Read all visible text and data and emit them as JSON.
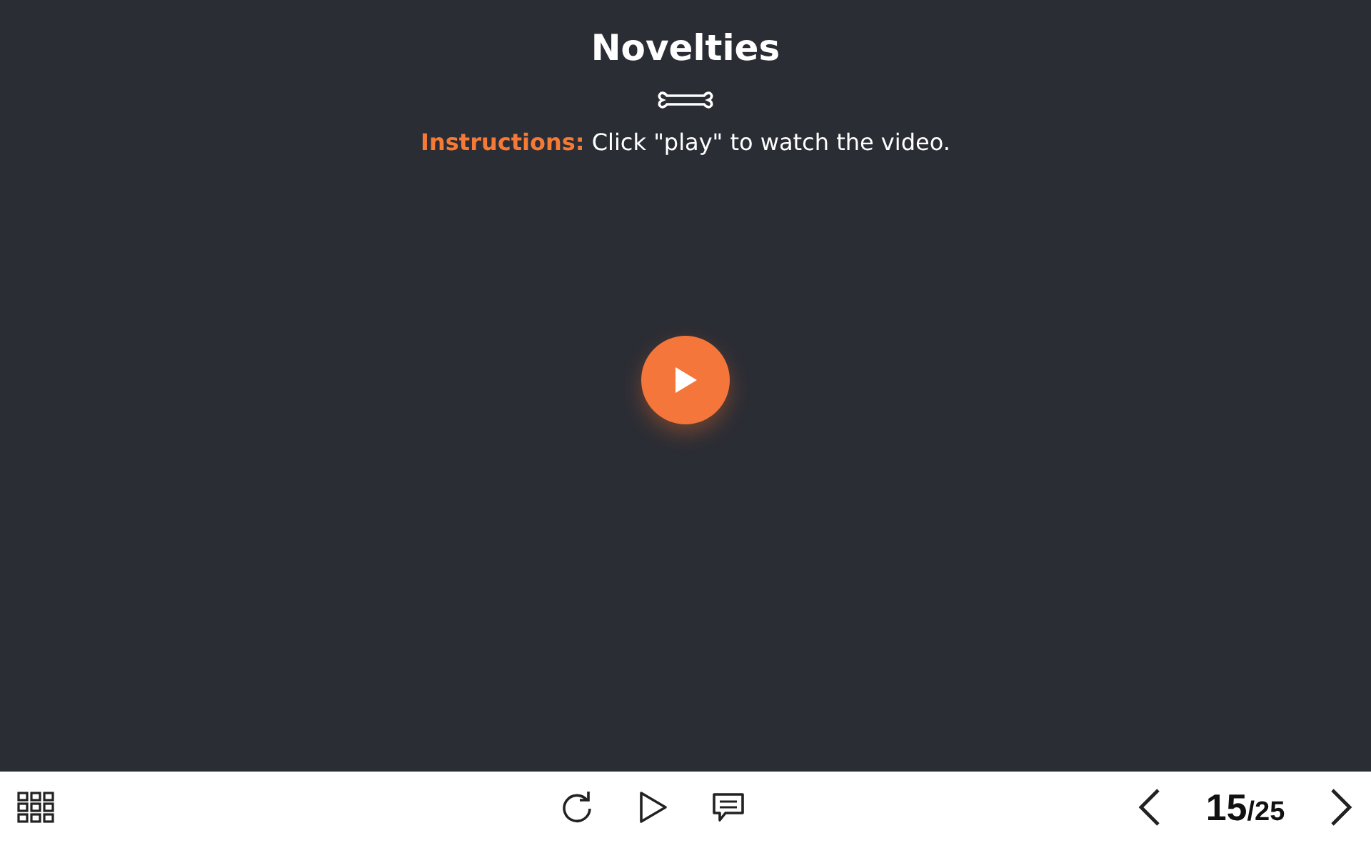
{
  "slide": {
    "title": "Novelties",
    "instructions_label": "Instructions:",
    "instructions_text": "Click \"play\" to watch the video."
  },
  "player": {
    "current_page": "15",
    "total_pages": "/25"
  }
}
